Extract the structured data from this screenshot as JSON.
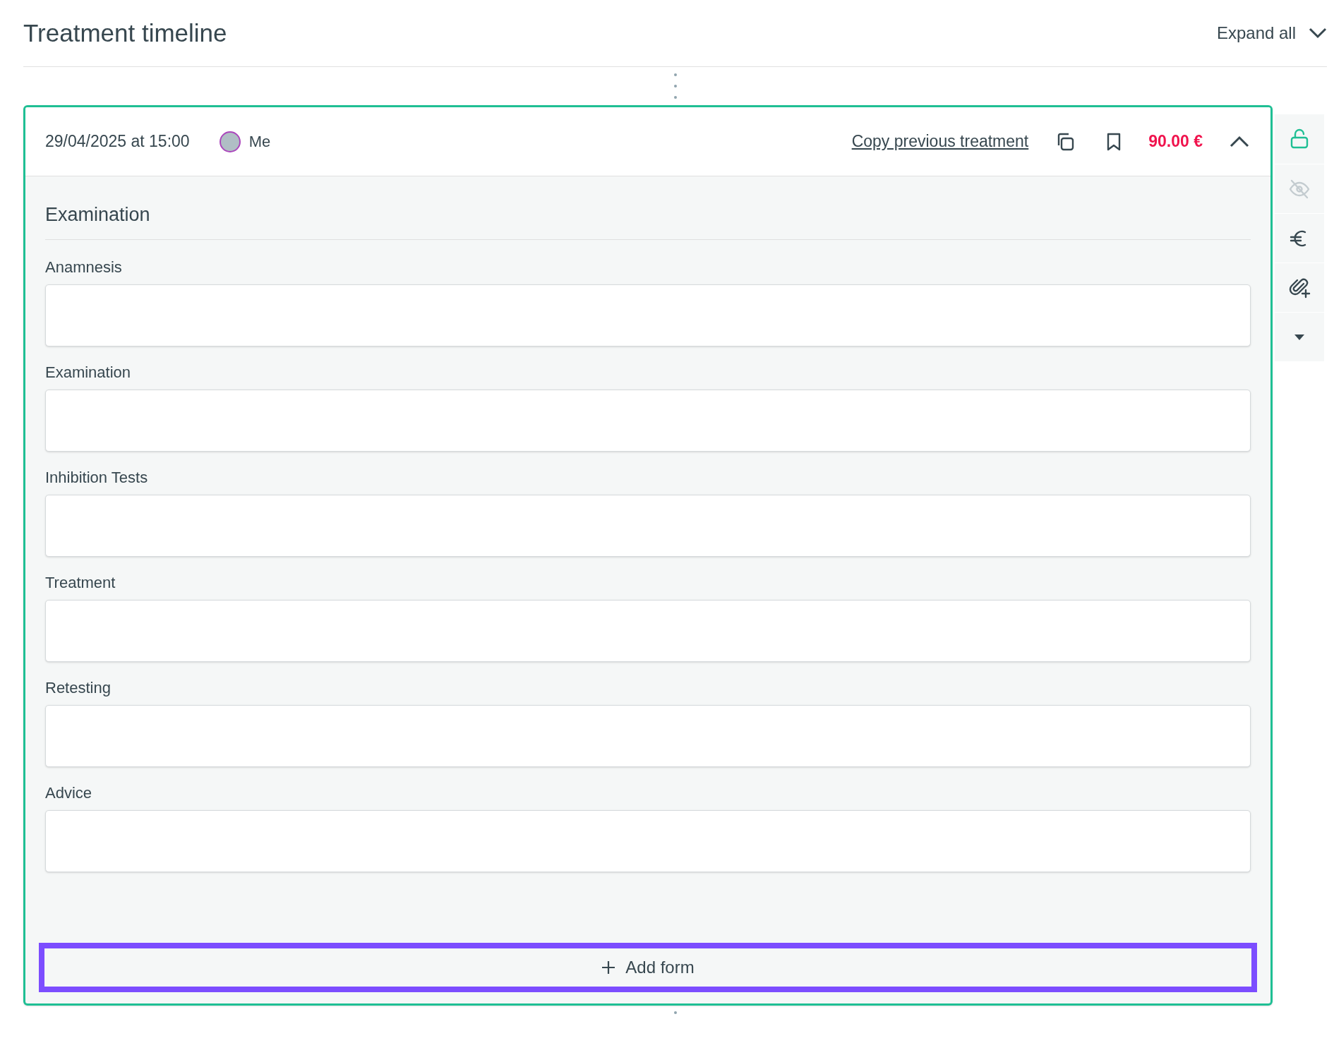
{
  "page": {
    "title": "Treatment timeline",
    "expand_all": "Expand all"
  },
  "treatment": {
    "date": "29/04/2025 at 15:00",
    "therapist": "Me",
    "copy_link": "Copy previous treatment",
    "price": "90.00 €",
    "expanded": true,
    "section_title": "Examination",
    "fields": [
      {
        "label": "Anamnesis"
      },
      {
        "label": "Examination"
      },
      {
        "label": "Inhibition Tests"
      },
      {
        "label": "Treatment"
      },
      {
        "label": "Retesting"
      },
      {
        "label": "Advice"
      }
    ],
    "add_form": {
      "label": "Add form",
      "highlighted": true
    }
  },
  "side_actions": [
    {
      "kind": "lock",
      "active": true,
      "disabled": false
    },
    {
      "kind": "hide",
      "active": false,
      "disabled": true
    },
    {
      "kind": "price",
      "active": false,
      "disabled": false
    },
    {
      "kind": "attach",
      "active": false,
      "disabled": false
    },
    {
      "kind": "more",
      "active": false,
      "disabled": false
    }
  ]
}
